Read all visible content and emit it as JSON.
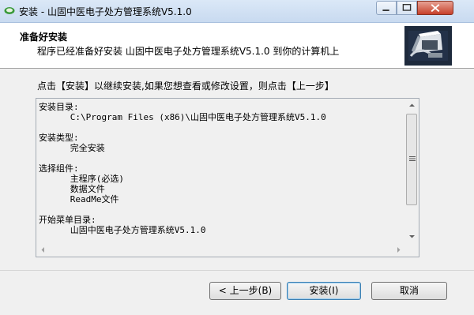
{
  "window": {
    "title": "安装 - 山固中医电子处方管理系统V5.1.0"
  },
  "header": {
    "title": "准备好安装",
    "subtitle": "程序已经准备好安装 山固中医电子处方管理系统V5.1.0 到你的计算机上"
  },
  "body": {
    "instruction": "点击【安装】以继续安装,如果您想查看或修改设置，则点击【上一步】"
  },
  "memo": {
    "lines": [
      "安装目录:",
      "      C:\\Program Files (x86)\\山固中医电子处方管理系统V5.1.0",
      "",
      "安装类型:",
      "      完全安装",
      "",
      "选择组件:",
      "      主程序(必选)",
      "      数据文件",
      "      ReadMe文件",
      "",
      "开始菜单目录:",
      "      山固中医电子处方管理系统V5.1.0"
    ]
  },
  "buttons": {
    "back": "< 上一步(B)",
    "install": "安装(I)",
    "cancel": "取消"
  },
  "icons": {
    "app": "app-icon",
    "logo": "computer-install-icon"
  }
}
